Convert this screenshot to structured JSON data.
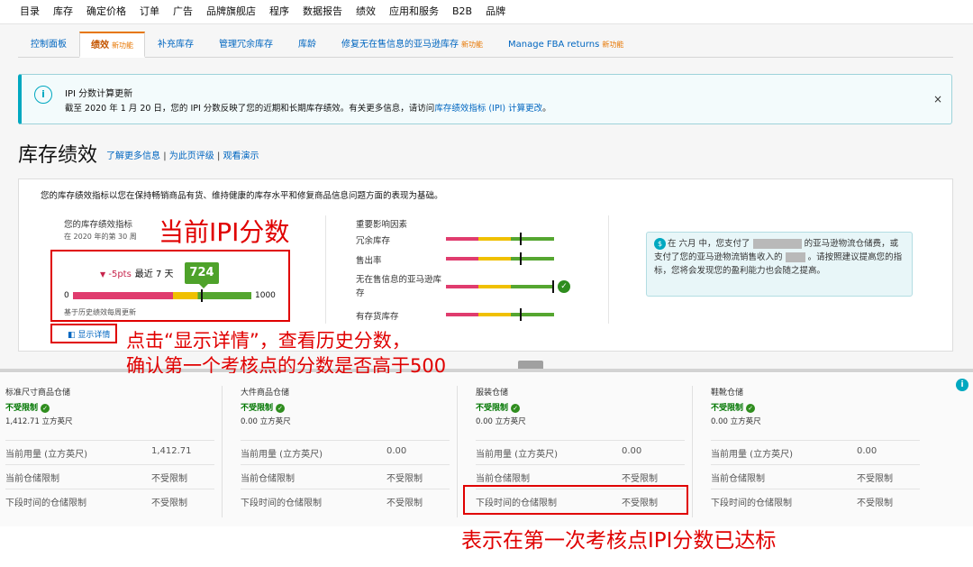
{
  "topnav": [
    "目录",
    "库存",
    "确定价格",
    "订单",
    "广告",
    "品牌旗舰店",
    "程序",
    "数据报告",
    "绩效",
    "应用和服务",
    "B2B",
    "品牌"
  ],
  "tabs": [
    {
      "label": "控制面板",
      "tag": ""
    },
    {
      "label": "绩效",
      "tag": "新功能"
    },
    {
      "label": "补充库存",
      "tag": ""
    },
    {
      "label": "管理冗余库存",
      "tag": ""
    },
    {
      "label": "库龄",
      "tag": ""
    },
    {
      "label": "修复无在售信息的亚马逊库存",
      "tag": "新功能"
    },
    {
      "label": "Manage FBA returns",
      "tag": "新功能"
    }
  ],
  "banner": {
    "icon": "i",
    "title": "IPI 分数计算更新",
    "text": "截至 2020 年 1 月 20 日，您的 IPI 分数反映了您的近期和长期库存绩效。有关更多信息，请访问",
    "link": "库存绩效指标 (IPI) 计算更改",
    "end": "。",
    "close": "×"
  },
  "page": {
    "title": "库存绩效",
    "link1": "了解更多信息",
    "sep": "|",
    "link2": "为此页评级",
    "link3": "观看演示"
  },
  "card": {
    "desc": "您的库存绩效指标以您在保持畅销商品有货、维持健康的库存水平和修复商品信息问题方面的表现为基础。",
    "gauge_title": "您的库存绩效指标",
    "gauge_week": "在 2020 年的第 30 周",
    "delta": "-5pts",
    "delta_period": "最近 7 天",
    "score": "724",
    "score_value": 724,
    "min": "0",
    "max": "1000",
    "note": "基于历史绩效每周更新",
    "show_detail": "显示详情"
  },
  "factors": {
    "title": "重要影响因素",
    "items": [
      {
        "label": "冗余库存",
        "level": 0.7
      },
      {
        "label": "售出率",
        "level": 0.7
      },
      {
        "label": "无在售信息的亚马逊库存",
        "level": 1.0,
        "check": true
      },
      {
        "label": "有存货库存",
        "level": 0.7
      }
    ]
  },
  "tip": {
    "p1": "在 六月 中，您支付了",
    "p2": "的亚马逊物流仓储费，或支付了您的亚马逊物流销售收入的",
    "p3": "。请按照建议提高您的指标，您将会发现您的盈利能力也会随之提高。"
  },
  "annotations": {
    "current_score": "当前IPI分数",
    "click_detail_1": "点击“显示详情”，查看历史分数，",
    "click_detail_2": "确认第一个考核点的分数是否高于500",
    "met_standard": "表示在第一次考核点IPI分数已达标"
  },
  "storage": [
    {
      "title": "标准尺寸商品仓储",
      "status": "不受限制",
      "volume": "1,412.71 立方英尺",
      "rows": [
        {
          "k": "当前用量 (立方英尺)",
          "v": "1,412.71"
        },
        {
          "k": "当前仓储限制",
          "v": "不受限制"
        },
        {
          "k": "下段时间的仓储限制",
          "v": "不受限制"
        }
      ]
    },
    {
      "title": "大件商品仓储",
      "status": "不受限制",
      "volume": "0.00 立方英尺",
      "rows": [
        {
          "k": "当前用量 (立方英尺)",
          "v": "0.00"
        },
        {
          "k": "当前仓储限制",
          "v": "不受限制"
        },
        {
          "k": "下段时间的仓储限制",
          "v": "不受限制"
        }
      ]
    },
    {
      "title": "服装仓储",
      "status": "不受限制",
      "volume": "0.00 立方英尺",
      "rows": [
        {
          "k": "当前用量 (立方英尺)",
          "v": "0.00"
        },
        {
          "k": "当前仓储限制",
          "v": "不受限制"
        },
        {
          "k": "下段时间的仓储限制",
          "v": "不受限制"
        }
      ]
    },
    {
      "title": "鞋靴仓储",
      "status": "不受限制",
      "volume": "0.00 立方英尺",
      "rows": [
        {
          "k": "当前用量 (立方英尺)",
          "v": "0.00"
        },
        {
          "k": "当前仓储限制",
          "v": "不受限制"
        },
        {
          "k": "下段时间的仓储限制",
          "v": "不受限制"
        }
      ]
    }
  ],
  "colors": {
    "link": "#0066c0",
    "active_tab": "#c45500",
    "annotation_red": "#e00000",
    "score_green": "#4ea22a",
    "negative": "#c7244c",
    "status_green": "#007600"
  }
}
